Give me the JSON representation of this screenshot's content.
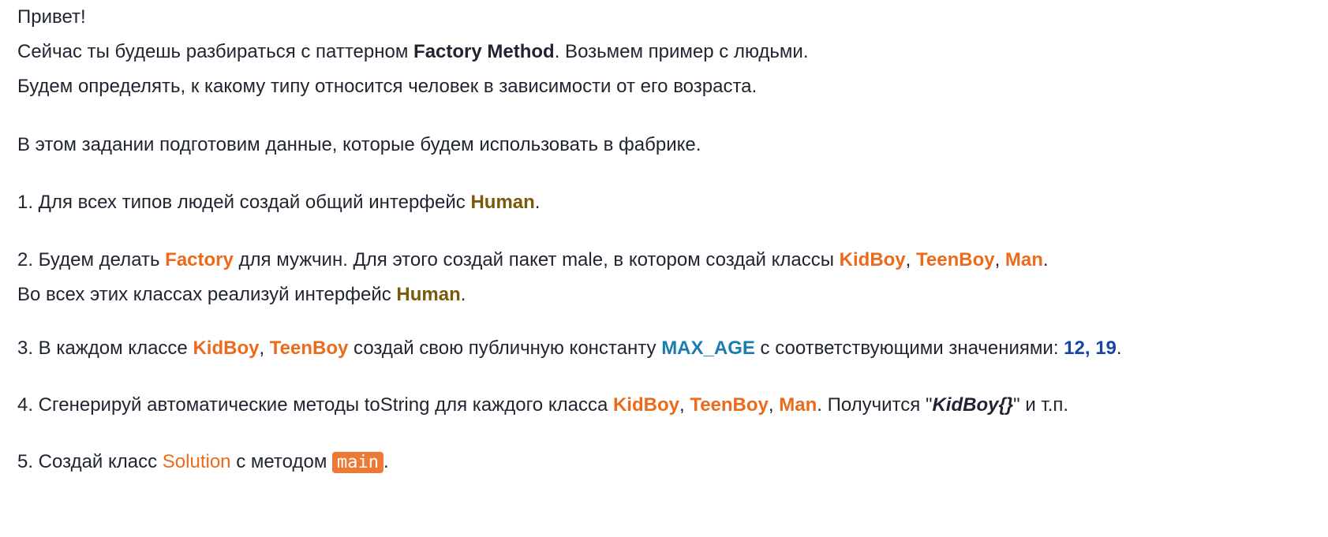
{
  "greeting": "Привет!",
  "intro": {
    "t1": "Сейчас ты будешь разбираться с паттерном ",
    "pattern": "Factory Method",
    "t2": ". Возьмем пример с людьми."
  },
  "intro2": "Будем определять, к какому типу относится человек в зависимости от его возраста.",
  "intro3": "В этом задании подготовим данные, которые будем использовать в фабрике.",
  "step1": {
    "t1": "1. Для всех типов людей создай общий интерфейс ",
    "iface": "Human",
    "t2": "."
  },
  "step2": {
    "t1": "2. Будем делать ",
    "factory": "Factory",
    "t2": " для мужчин. Для этого создай пакет male, в котором создай классы ",
    "c1": "KidBoy",
    "sep1": ", ",
    "c2": "TeenBoy",
    "sep2": ", ",
    "c3": "Man",
    "t3": "."
  },
  "step2b": {
    "t1": "Во всех этих классах реализуй интерфейс ",
    "iface": "Human",
    "t2": "."
  },
  "step3": {
    "t1": "3. В каждом классе ",
    "c1": "KidBoy",
    "sep1": ", ",
    "c2": "TeenBoy",
    "t2": " создай свою публичную константу ",
    "const": "MAX_AGE",
    "t3": " с соответствующими значениями: ",
    "values": "12, 19",
    "t4": "."
  },
  "step4": {
    "t1": "4. Сгенерируй автоматические методы toString для каждого класса ",
    "c1": "KidBoy",
    "sep1": ", ",
    "c2": "TeenBoy",
    "sep2": ", ",
    "c3": "Man",
    "t2": ". Получится \"",
    "example": "KidBoy{}",
    "t3": "\" и т.п."
  },
  "step5": {
    "t1": "5. Создай класс ",
    "cls": "Solution",
    "t2": " с методом ",
    "method": "main",
    "t3": "."
  },
  "colors": {
    "accent": "#ec6a1c",
    "interface": "#7a5a08",
    "constant": "#1a7db0",
    "number": "#1844a6"
  }
}
